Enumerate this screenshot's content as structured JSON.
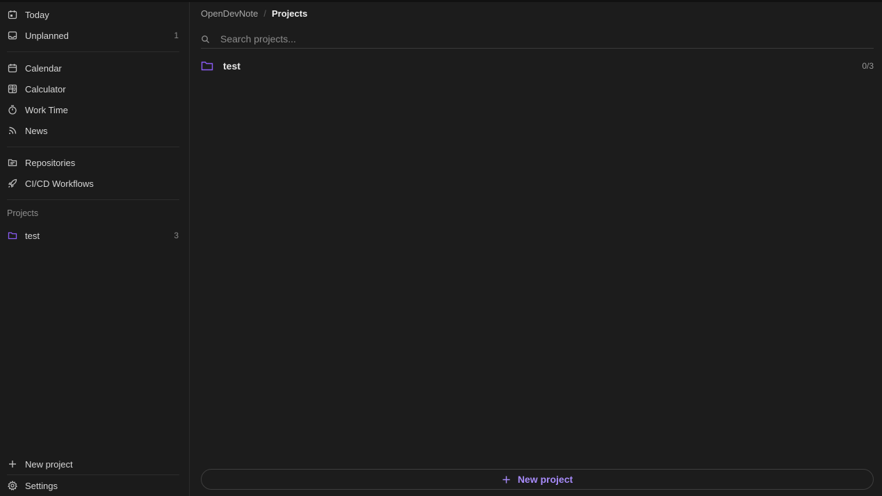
{
  "colors": {
    "accent": "#a78bfa",
    "folder": "#8b5cf6",
    "background": "#1c1c1c",
    "sidebar_bg": "#1b1b1b"
  },
  "sidebar": {
    "items": [
      {
        "label": "Today",
        "icon": "calendar-day-icon",
        "count": ""
      },
      {
        "label": "Unplanned",
        "icon": "inbox-icon",
        "count": "1"
      },
      {
        "label": "Calendar",
        "icon": "calendar-icon",
        "count": ""
      },
      {
        "label": "Calculator",
        "icon": "calculator-icon",
        "count": ""
      },
      {
        "label": "Work Time",
        "icon": "stopwatch-icon",
        "count": ""
      },
      {
        "label": "News",
        "icon": "rss-icon",
        "count": ""
      },
      {
        "label": "Repositories",
        "icon": "folder-code-icon",
        "count": ""
      },
      {
        "label": "CI/CD Workflows",
        "icon": "rocket-icon",
        "count": ""
      }
    ],
    "projects_title": "Projects",
    "projects": [
      {
        "label": "test",
        "icon": "folder-icon",
        "count": "3"
      }
    ],
    "new_project_label": "New project",
    "settings_label": "Settings"
  },
  "breadcrumb": {
    "root": "OpenDevNote",
    "separator": "/",
    "current": "Projects"
  },
  "search": {
    "placeholder": "Search projects...",
    "value": ""
  },
  "projects": [
    {
      "name": "test",
      "progress": "0/3",
      "icon": "folder-icon"
    }
  ],
  "new_project_button": {
    "label": "New project",
    "icon": "plus-icon"
  }
}
